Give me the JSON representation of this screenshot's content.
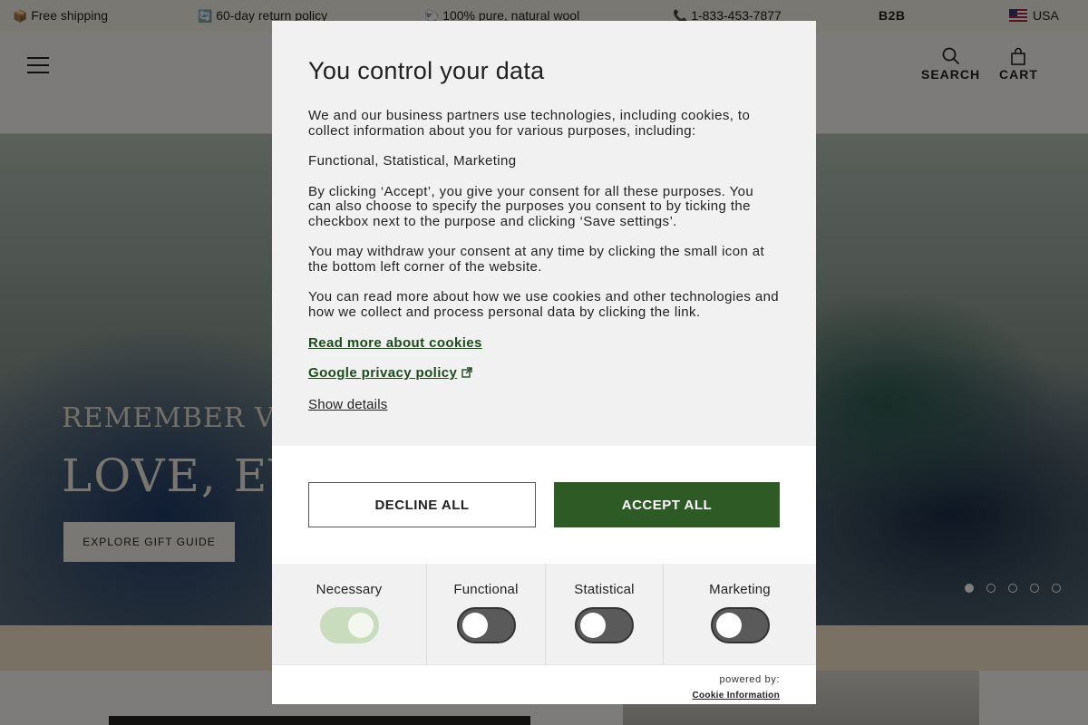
{
  "topbar": {
    "items": [
      {
        "icon": "📦",
        "text": "Free shipping"
      },
      {
        "icon": "🔄",
        "text": "60-day return policy"
      },
      {
        "icon": "🐑",
        "text": "100% pure, natural wool"
      },
      {
        "icon": "📞",
        "text": "1-833-453-7877"
      }
    ],
    "b2b": "B2B",
    "country": "USA"
  },
  "header": {
    "search_label": "SEARCH",
    "cart_label": "CART"
  },
  "hero": {
    "subtitle": "REMEMBER VALE",
    "title": "LOVE, EVE",
    "cta": "EXPLORE GIFT GUIDE",
    "slides": 5,
    "active_slide": 1
  },
  "consent": {
    "title": "You control your data",
    "p1": "We and our business partners use technologies, including cookies, to collect information about you for various purposes, including:",
    "p2": "Functional, Statistical, Marketing",
    "p3": "By clicking ‘Accept’, you give your consent for all these purposes. You can also choose to specify the purposes you consent to by ticking the checkbox next to the purpose and clicking ‘Save settings’.",
    "p4": "You may withdraw your consent at any time by clicking the small icon at the bottom left corner of the website.",
    "p5": "You can read more about how we use cookies and other technologies and how we collect and process personal data by clicking the link.",
    "link_cookies": "Read more about cookies",
    "link_google": "Google privacy policy",
    "show_details": "Show details",
    "decline_label": "DECLINE ALL",
    "accept_label": "ACCEPT ALL",
    "categories": [
      {
        "label": "Necessary",
        "enabled": true,
        "locked": true
      },
      {
        "label": "Functional",
        "enabled": false
      },
      {
        "label": "Statistical",
        "enabled": false
      },
      {
        "label": "Marketing",
        "enabled": false
      }
    ],
    "powered_by": "powered by:",
    "provider": "Cookie Information"
  },
  "colors": {
    "accent": "#2e5a26",
    "link": "#1e4a1e"
  }
}
